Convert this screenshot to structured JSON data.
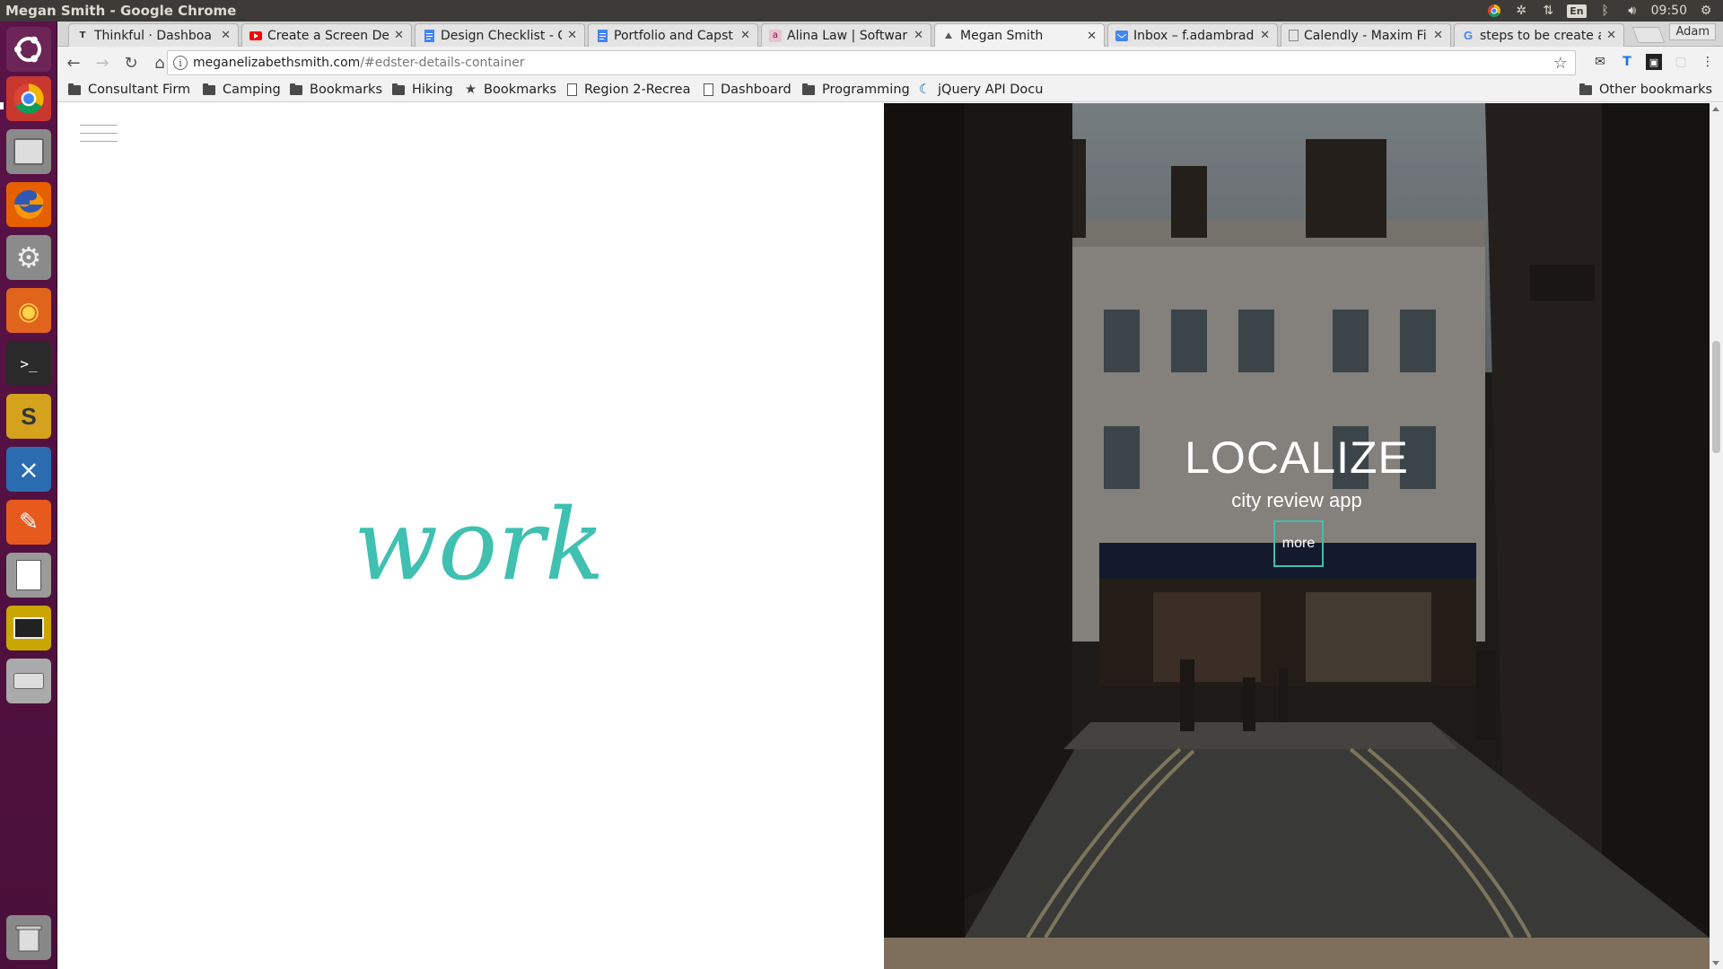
{
  "panel": {
    "window_title": "Megan Smith - Google Chrome",
    "keyboard": "En",
    "clock": "09:50"
  },
  "tabs": [
    {
      "label": "Thinkful · Dashboa",
      "favicon": "thinkful-icon",
      "color": "#333333"
    },
    {
      "label": "Create a Screen De",
      "favicon": "youtube-icon",
      "color": "#ff0000"
    },
    {
      "label": "Design Checklist - C",
      "favicon": "google-docs-icon",
      "color": "#4285f4"
    },
    {
      "label": "Portfolio and Capst",
      "favicon": "google-docs-icon",
      "color": "#4285f4"
    },
    {
      "label": "Alina Law | Softwar",
      "favicon": "alina-icon",
      "color": "#c08ba0"
    },
    {
      "label": "Megan Smith",
      "favicon": "site-icon",
      "color": "#555555"
    },
    {
      "label": "Inbox – f.adambrad",
      "favicon": "inbox-icon",
      "color": "#4285f4"
    },
    {
      "label": "Calendly - Maxim Fi",
      "favicon": "calendly-icon",
      "color": "#777777"
    },
    {
      "label": "steps to be create a",
      "favicon": "google-icon",
      "color": "#4285f4"
    }
  ],
  "profile_name": "Adam",
  "address": {
    "host": "meganelizabethsmith.com",
    "path": "/#edster-details-container"
  },
  "bookmarks": [
    {
      "label": "Consultant Firm",
      "kind": "folder"
    },
    {
      "label": "Camping",
      "kind": "folder"
    },
    {
      "label": "Bookmarks",
      "kind": "folder"
    },
    {
      "label": "Hiking",
      "kind": "folder"
    },
    {
      "label": "Bookmarks",
      "kind": "star"
    },
    {
      "label": "Region 2-Recrea",
      "kind": "page"
    },
    {
      "label": "Dashboard",
      "kind": "page"
    },
    {
      "label": "Programming",
      "kind": "folder"
    },
    {
      "label": "jQuery API Docu",
      "kind": "jquery"
    }
  ],
  "other_bookmarks": "Other bookmarks",
  "page": {
    "work_heading": "work",
    "hero_title": "LOCALIZE",
    "hero_subtitle": "city review app",
    "more_label": "more"
  },
  "colors": {
    "accent_teal": "#3fc0b1",
    "launcher": "#5b1348"
  }
}
